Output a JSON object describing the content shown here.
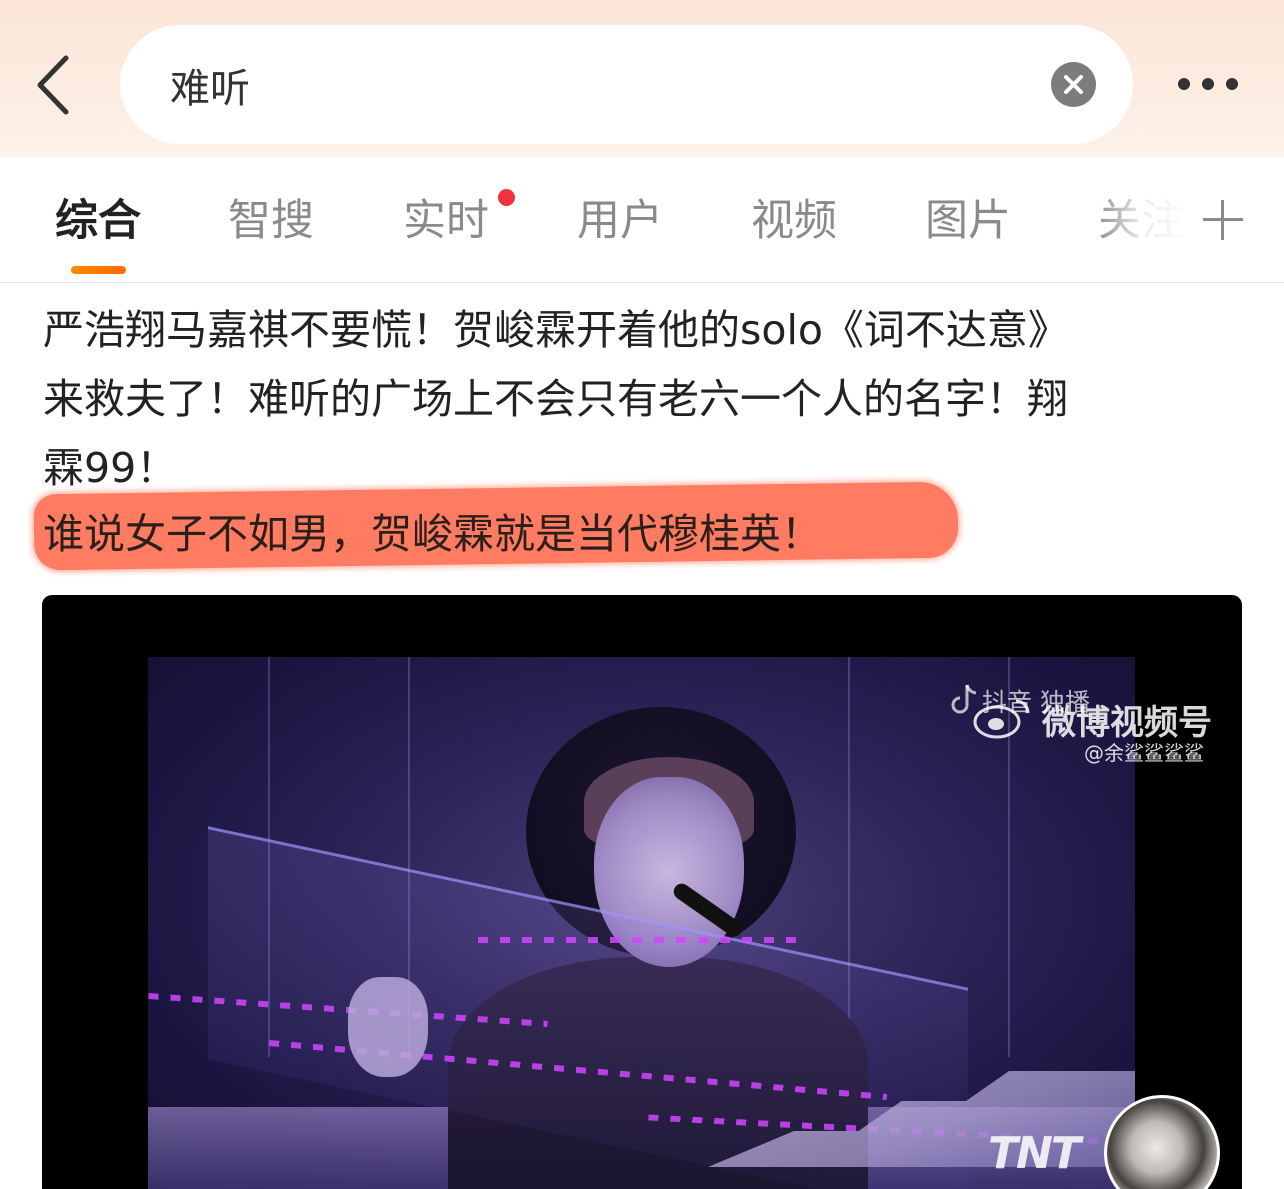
{
  "search": {
    "query": "难听"
  },
  "tabs": [
    {
      "label": "综合",
      "active": true
    },
    {
      "label": "智搜",
      "active": false
    },
    {
      "label": "实时",
      "active": false,
      "has_new_dot": true
    },
    {
      "label": "用户",
      "active": false
    },
    {
      "label": "视频",
      "active": false
    },
    {
      "label": "图片",
      "active": false
    },
    {
      "label": "关注",
      "active": false
    }
  ],
  "post": {
    "lines": [
      "严浩翔马嘉祺不要慌！贺峻霖开着他的solo《词不达意》",
      "来救夫了！难听的广场上不会只有老六一个人的名字！翔",
      "霖99！"
    ],
    "highlighted_line": "谁说女子不如男，贺峻霖就是当代穆桂英！",
    "highlight_color": "#ff6a4d"
  },
  "video": {
    "watermark_douyin": "抖音 独播",
    "watermark_weibo": "微博视频号",
    "watermark_handle": "@余鲨鲨鲨鲨",
    "corner_logo": "TNT"
  },
  "colors": {
    "accent": "#ff7a00",
    "new_dot": "#f0333b",
    "header_bg": "#fbe6d8"
  },
  "icons": [
    "chevron-left-icon",
    "clear-icon",
    "more-icon",
    "plus-icon",
    "douyin-icon",
    "weibo-icon"
  ]
}
